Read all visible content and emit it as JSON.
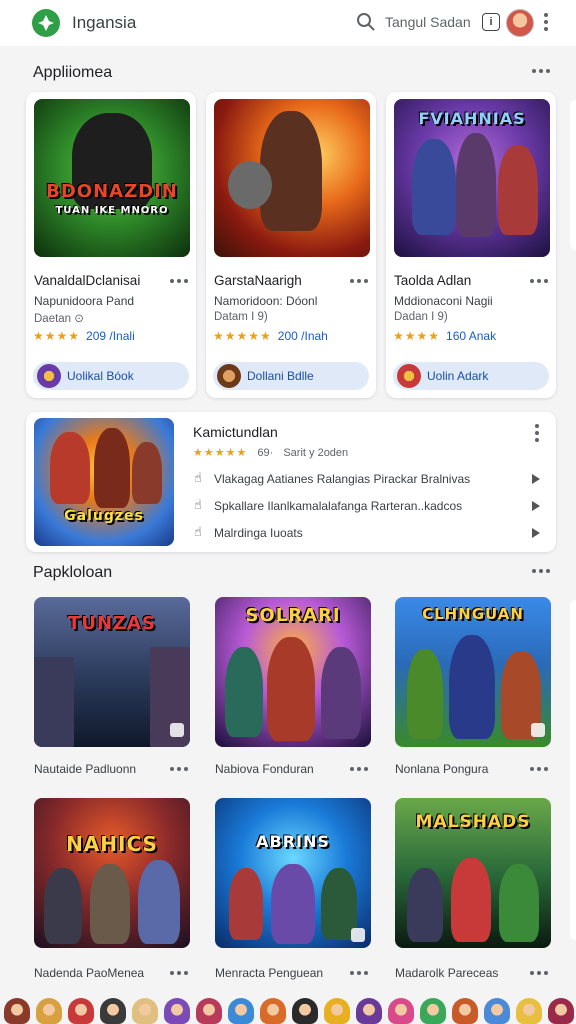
{
  "header": {
    "app_name": "Ingansia",
    "search_placeholder": "Tangul Sadan",
    "info_glyph": "i"
  },
  "section1": {
    "title": "Appliiomea",
    "cards": [
      {
        "art_title": "BDONAZDIN",
        "art_subtitle": "TUAN IKE MNORO",
        "title": "VanaldalDclanisai",
        "subtitle": "Napunidoora Pand",
        "date": "Daetan ⊙",
        "stars": "★★★★",
        "rating": "209 /Inali",
        "button": "Uolikal Bóok",
        "colors": [
          "#2f8a2a",
          "#0d2e0d"
        ]
      },
      {
        "art_title": "",
        "art_subtitle": "",
        "title": "GarstaNaarigh",
        "subtitle": "Namoridoon: Dóonl",
        "date": "Datam I 9)",
        "stars": "★★★★★",
        "rating": "200 /Inah",
        "button": "Dollani Bdlle",
        "colors": [
          "#c8531a",
          "#3a1208"
        ]
      },
      {
        "art_title": "FVIAHNIAS",
        "art_subtitle": "",
        "title": "Taolda Adlan",
        "subtitle": "Mddionaconi Nagii",
        "date": "Dadan I 9)",
        "stars": "★★★★",
        "rating": "160 Anak",
        "button": "Uolin Adark",
        "colors": [
          "#6a3aa8",
          "#1c1040"
        ]
      }
    ]
  },
  "featured": {
    "art_title": "Galugzes",
    "title": "Kamictundlan",
    "stars": "★★★★★",
    "rating_count": "69·",
    "meta": "Sarit y 2oden",
    "items": [
      "Vlakagag Aatianes Ralangias Pirackar Bralnivas",
      "Spkallare Ilanlkamalalafanga Rarteran..kadcos",
      "Malrdinga Iuoats"
    ]
  },
  "section2": {
    "title": "Papkloloan",
    "tiles": [
      {
        "art_title": "TUNZAS",
        "caption": "Nautaide Padluonn",
        "colors": [
          "#3a4a6a",
          "#10182a"
        ]
      },
      {
        "art_title": "SOLRARI",
        "caption": "Nabiova Fonduran",
        "colors": [
          "#6a3ab8",
          "#1a0f3a"
        ]
      },
      {
        "art_title": "CLHNGUAN",
        "caption": "Nonlana Pongura",
        "colors": [
          "#2a6ab8",
          "#3a8a2a"
        ]
      },
      {
        "art_title": "NAHICS",
        "caption": "Nadenda PaoMenea",
        "colors": [
          "#8a2a2a",
          "#1a1020"
        ]
      },
      {
        "art_title": "ABRINS",
        "caption": "Menracta Penguean",
        "colors": [
          "#1a7ad8",
          "#0a2a6a"
        ]
      },
      {
        "art_title": "MALSHADS",
        "caption": "Madarolk Pareceas",
        "colors": [
          "#2a6a3a",
          "#0a1a10"
        ]
      }
    ]
  },
  "strip_colors": [
    "#8a3a2a",
    "#d8a040",
    "#c83a3a",
    "#3a3a3a",
    "#e0c080",
    "#7a4ab8",
    "#b83a5a",
    "#3a8ad8",
    "#d86a2a",
    "#2a2a2a",
    "#e8b020",
    "#6a3a9a",
    "#d84a8a",
    "#3aa85a",
    "#c85a2a",
    "#4a8ad8",
    "#e8c040",
    "#9a2a4a",
    "#2a9aa8",
    "#d8d020",
    "#5a3aa8"
  ]
}
